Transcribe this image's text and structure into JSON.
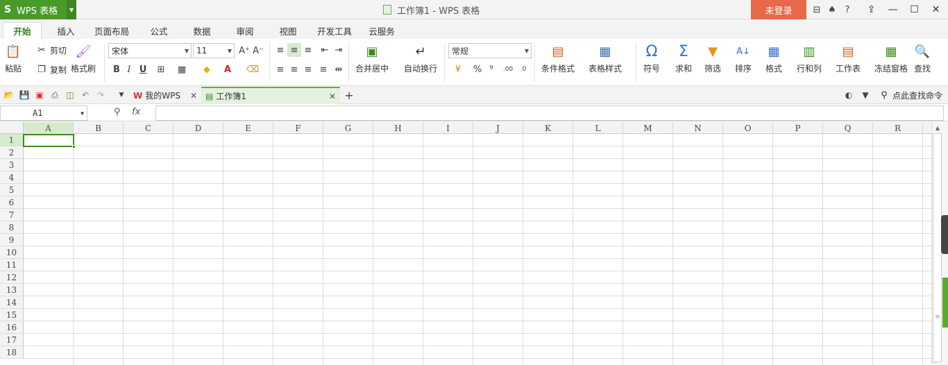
{
  "app": {
    "logo_label": "WPS 表格",
    "window_title": "工作簿1 - WPS 表格",
    "login_label": "未登录",
    "help_label": "?"
  },
  "tabs": [
    {
      "label": "开始",
      "active": true
    },
    {
      "label": "插入"
    },
    {
      "label": "页面布局"
    },
    {
      "label": "公式"
    },
    {
      "label": "数据"
    },
    {
      "label": "审阅"
    },
    {
      "label": "视图"
    },
    {
      "label": "开发工具"
    },
    {
      "label": "云服务"
    }
  ],
  "ribbon": {
    "paste": "粘贴",
    "cut": "剪切",
    "copy": "复制",
    "format_painter": "格式刷",
    "font_name": "宋体",
    "font_size": "11",
    "bold": "B",
    "italic": "I",
    "underline": "U",
    "merge_center": "合并居中",
    "wrap_text": "自动换行",
    "number_format": "常规",
    "percent": "%",
    "thousands": "⁹",
    "conditional_format": "条件格式",
    "table_style": "表格样式",
    "symbol": "符号",
    "sum": "求和",
    "filter": "筛选",
    "sort": "排序",
    "format": "格式",
    "rows_cols": "行和列",
    "worksheet": "工作表",
    "freeze": "冻结窗格",
    "find": "查找"
  },
  "quickbar": {
    "doc_tabs": [
      {
        "label": "我的WPS",
        "active": false
      },
      {
        "label": "工作簿1",
        "active": true
      }
    ],
    "search_label": "点此查找命令"
  },
  "formula": {
    "name_box": "A1",
    "fx": "fx",
    "value": ""
  },
  "sheet": {
    "columns": [
      "A",
      "B",
      "C",
      "D",
      "E",
      "F",
      "G",
      "H",
      "I",
      "J",
      "K",
      "L",
      "M",
      "N",
      "O",
      "P",
      "Q",
      "R"
    ],
    "rows": [
      "1",
      "2",
      "3",
      "4",
      "5",
      "6",
      "7",
      "8",
      "9",
      "10",
      "11",
      "12",
      "13",
      "14",
      "15",
      "16",
      "17",
      "18"
    ],
    "active_cell": "A1"
  },
  "colors": {
    "accent_green": "#4a9a2a",
    "login_orange": "#e8694a",
    "selection_green": "#3b8c1c"
  },
  "icons": {
    "paste": "clipboard-icon",
    "cut": "scissors-icon",
    "copy": "copy-icon",
    "format_painter": "brush-icon",
    "symbol": "omega-icon",
    "sum": "sigma-icon",
    "filter": "funnel-icon",
    "find": "magnifier-icon"
  }
}
